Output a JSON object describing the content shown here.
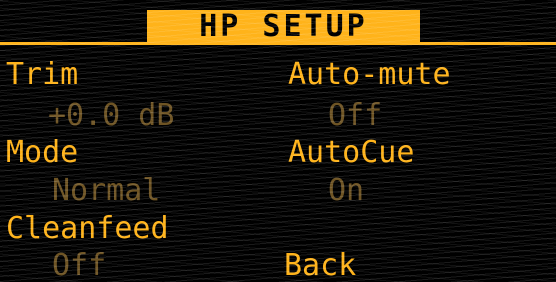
{
  "title": "HP SETUP",
  "left": [
    {
      "label": "Trim",
      "value": "+0.0 dB"
    },
    {
      "label": "Mode",
      "value": "Normal"
    },
    {
      "label": "Cleanfeed",
      "value": "Off"
    }
  ],
  "right": [
    {
      "label": "Auto-mute",
      "value": "Off"
    },
    {
      "label": "AutoCue",
      "value": "On"
    }
  ],
  "back_label": "Back",
  "colors": {
    "accent": "#ffb31a",
    "dim": "#6e5424",
    "background": "#000000"
  }
}
